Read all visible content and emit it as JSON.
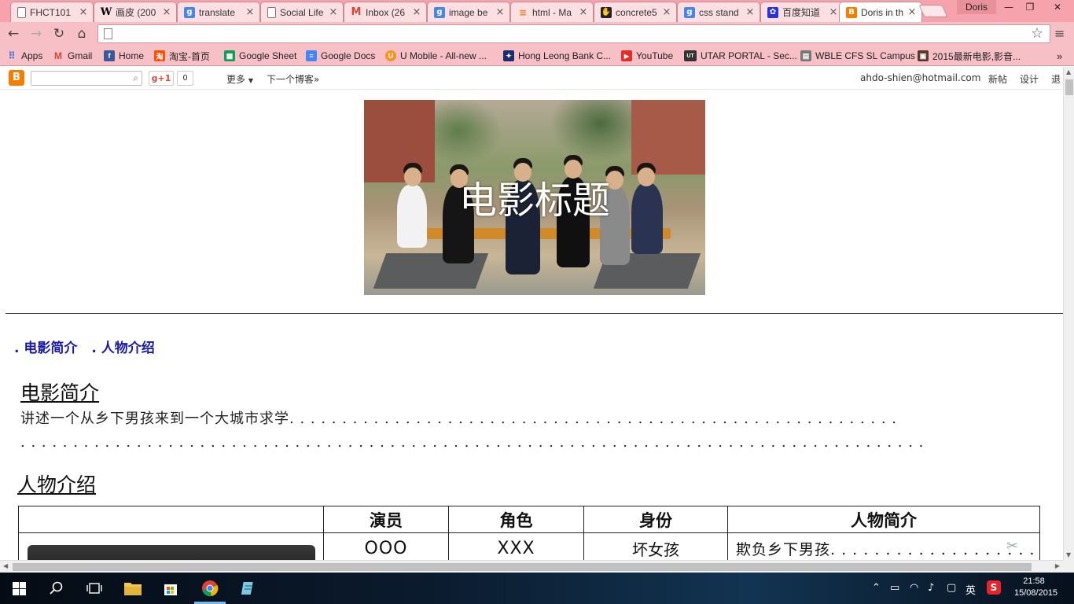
{
  "browser": {
    "tabs": [
      {
        "title": "FHCT101",
        "icon": "page"
      },
      {
        "title": "画皮 (200",
        "icon": "wikipedia"
      },
      {
        "title": "translate",
        "icon": "google"
      },
      {
        "title": "Social Life",
        "icon": "page"
      },
      {
        "title": "Inbox (26",
        "icon": "gmail"
      },
      {
        "title": "image be",
        "icon": "google"
      },
      {
        "title": "html - Ma",
        "icon": "stackoverflow"
      },
      {
        "title": "concrete5",
        "icon": "concrete5"
      },
      {
        "title": "css stand",
        "icon": "google"
      },
      {
        "title": "百度知道",
        "icon": "baidu"
      },
      {
        "title": "Doris in th",
        "icon": "blogger"
      }
    ],
    "profile_name": "Doris",
    "address": "",
    "bookmarks": [
      {
        "label": "Apps"
      },
      {
        "label": "Gmail"
      },
      {
        "label": "Home"
      },
      {
        "label": "淘宝-首页"
      },
      {
        "label": "Google Sheet"
      },
      {
        "label": "Google Docs"
      },
      {
        "label": "U Mobile - All-new ..."
      },
      {
        "label": "Hong Leong Bank C..."
      },
      {
        "label": "YouTube"
      },
      {
        "label": "UTAR PORTAL - Sec..."
      },
      {
        "label": "WBLE CFS SL Campus"
      },
      {
        "label": "2015最新电影,影音..."
      }
    ],
    "bookmarks_more": "»"
  },
  "navbar": {
    "search_placeholder": "",
    "gplus_label": "g+1",
    "gplus_count": "0",
    "more_label": "更多",
    "next_blog_label": "下一个博客»",
    "email": "ahdo-shien@hotmail.com",
    "new_post_label": "新帖",
    "design_label": "设计",
    "signout_label": "退"
  },
  "page": {
    "header_title": "电影标题",
    "toc": [
      ". 电影简介",
      ". 人物介绍"
    ],
    "intro_heading": "电影简介",
    "intro_line1": "讲述一个从乡下男孩来到一个大城市求学. . . . . . . . . . . . . . . . . . . . . . . . . . . . . . . . . . . . . . . . . . . . . . . . . . . . . . . . . .",
    "intro_line2": ". . . . . . . . . . . . . . . . . . . . . . . . . . . . . . . . . . . . . . . . . . . . . . . . . . . . . . . . . . . . . . . . . . . . . . . . . . . . . . . . . . . . . .",
    "cast_heading": "人物介绍",
    "cast_table": {
      "headers": [
        "",
        "演员",
        "角色",
        "身份",
        "人物简介"
      ],
      "rows": [
        {
          "actor": "OOO",
          "role": "XXX",
          "identity": "坏女孩",
          "description": "欺负乡下男孩. . . . . . . . . . . . . . . . . . . . . . ."
        }
      ]
    }
  },
  "taskbar": {
    "ime_label": "英",
    "time": "21:58",
    "date": "15/08/2015"
  },
  "colors": {
    "tab_strip": "#f6a3ad",
    "toolbar": "#f7bfc6",
    "toc_link": "#1a1aa6",
    "taskbar": "#0b1b2e"
  }
}
